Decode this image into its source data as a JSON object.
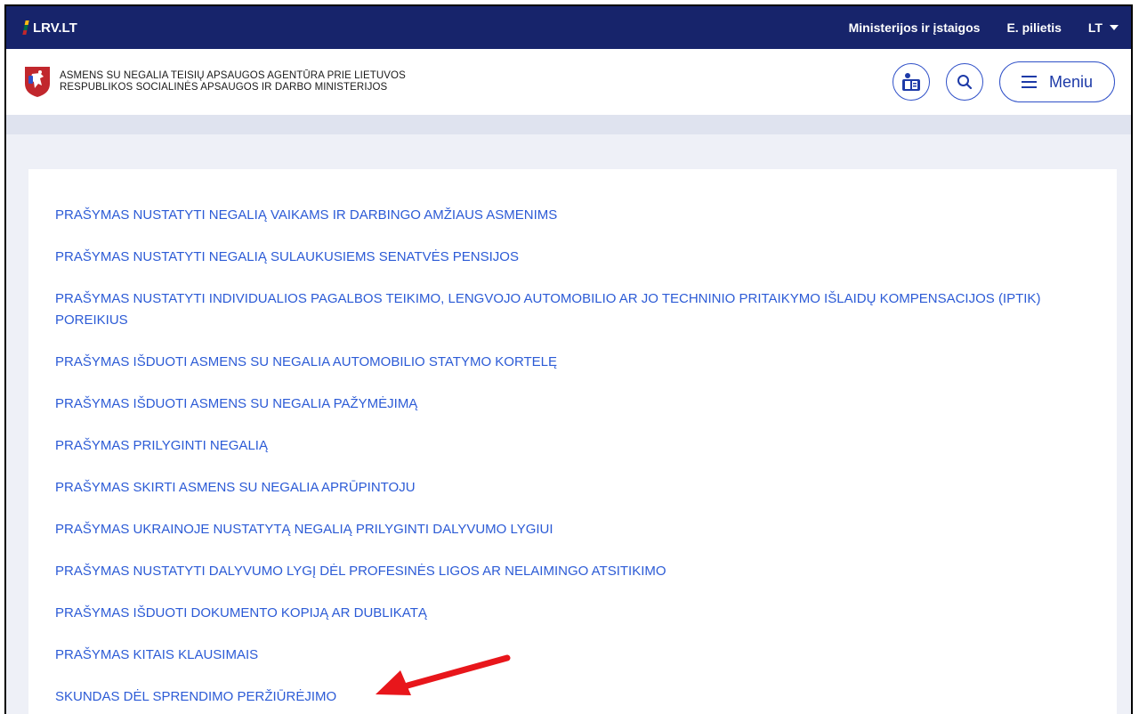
{
  "topbar": {
    "brand": "LRV.LT",
    "nav": [
      "Ministerijos ir įstaigos",
      "E. pilietis"
    ],
    "lang": "LT"
  },
  "header": {
    "agency_line1": "ASMENS SU NEGALIA TEISIŲ APSAUGOS AGENTŪRA PRIE LIETUVOS",
    "agency_line2": "RESPUBLIKOS SOCIALINĖS APSAUGOS IR DARBO MINISTERIJOS",
    "menu_label": "Meniu"
  },
  "links": [
    "PRAŠYMAS NUSTATYTI NEGALIĄ VAIKAMS IR DARBINGO AMŽIAUS ASMENIMS",
    "PRAŠYMAS NUSTATYTI NEGALIĄ SULAUKUSIEMS SENATVĖS PENSIJOS",
    "PRAŠYMAS NUSTATYTI INDIVIDUALIOS PAGALBOS TEIKIMO, LENGVOJO AUTOMOBILIO AR JO TECHNINIO PRITAIKYMO IŠLAIDŲ KOMPENSACIJOS (IPTIK) POREIKIUS",
    "PRAŠYMAS IŠDUOTI ASMENS SU NEGALIA AUTOMOBILIO STATYMO KORTELĘ",
    "PRAŠYMAS IŠDUOTI ASMENS SU NEGALIA PAŽYMĖJIMĄ",
    "PRAŠYMAS PRILYGINTI NEGALIĄ",
    "PRAŠYMAS SKIRTI ASMENS SU NEGALIA APRŪPINTOJU",
    "PRAŠYMAS UKRAINOJE NUSTATYTĄ NEGALIĄ PRILYGINTI DALYVUMO LYGIUI",
    "PRAŠYMAS NUSTATYTI DALYVUMO LYGĮ DĖL PROFESINĖS LIGOS AR NELAIMINGO ATSITIKIMO",
    "PRAŠYMAS IŠDUOTI DOKUMENTO KOPIJĄ  AR DUBLIKATĄ",
    "PRAŠYMAS KITAIS KLAUSIMAIS",
    "SKUNDAS DĖL SPRENDIMO PERŽIŪRĖJIMO"
  ],
  "colors": {
    "topbar_bg": "#17246b",
    "link": "#2c5bd6",
    "annotation_arrow": "#e8161b",
    "flag": [
      "#fdb913",
      "#006a44",
      "#c1272d"
    ]
  },
  "icons": [
    "easy-read-icon",
    "search-icon",
    "menu-icon",
    "red-arrow-annotation"
  ]
}
